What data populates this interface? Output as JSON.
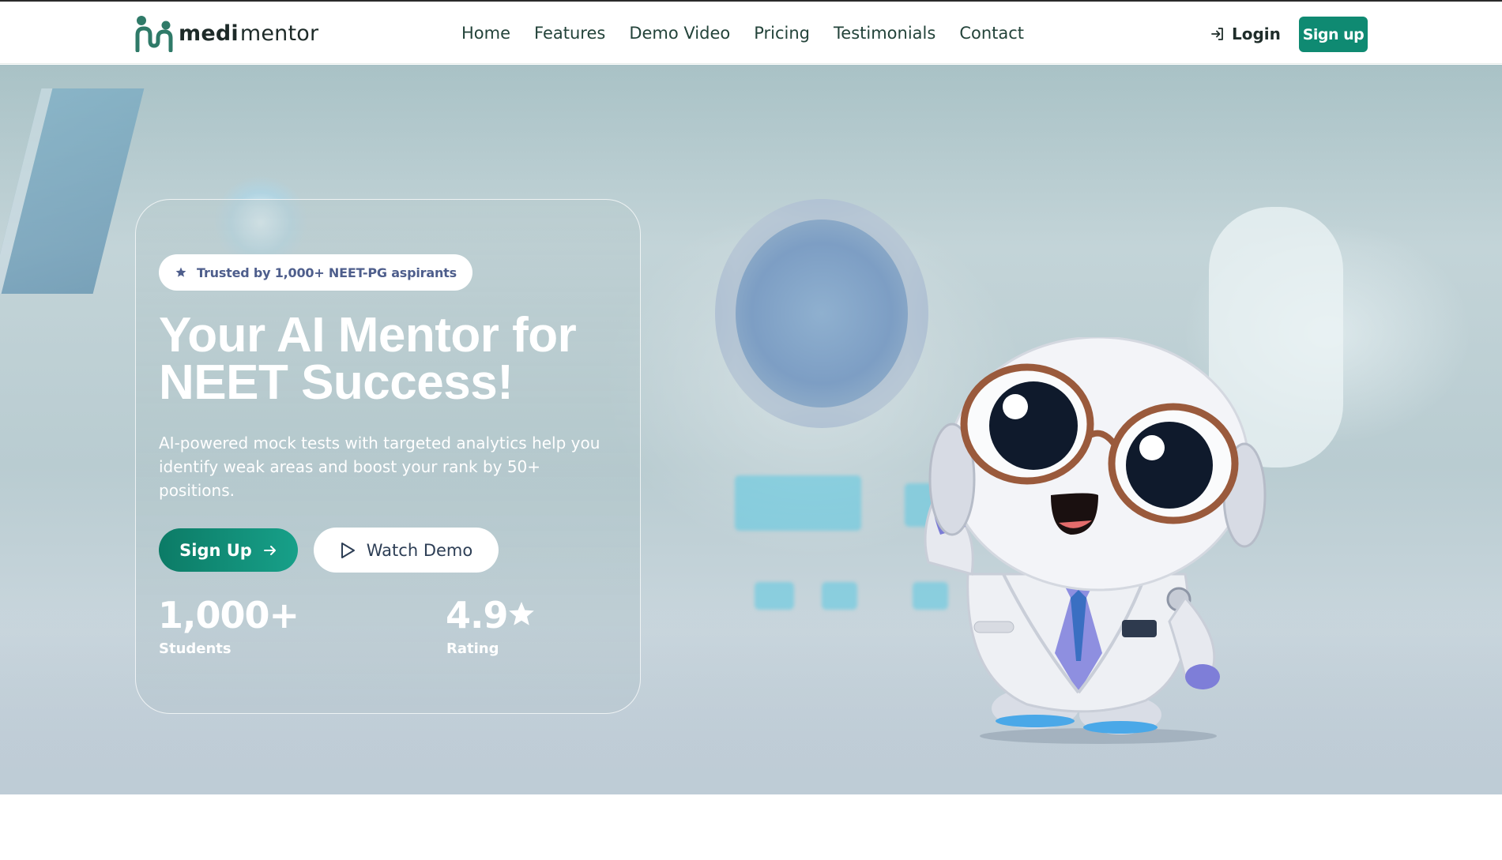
{
  "brand": {
    "name_bold": "medi",
    "name_light": "mentor"
  },
  "nav": {
    "links": [
      "Home",
      "Features",
      "Demo Video",
      "Pricing",
      "Testimonials",
      "Contact"
    ],
    "login": "Login",
    "signup": "Sign up"
  },
  "hero": {
    "badge": "Trusted by 1,000+ NEET-PG aspirants",
    "headline_line1": "Your AI Mentor for",
    "headline_line2": "NEET Success!",
    "subtitle": "AI-powered mock tests with targeted analytics help you identify weak areas and boost your rank by 50+ positions.",
    "cta_primary": "Sign Up",
    "cta_secondary": "Watch Demo",
    "stats": [
      {
        "value": "1,000+",
        "label": "Students"
      },
      {
        "value": "4.9",
        "label": "Rating"
      }
    ]
  },
  "colors": {
    "accent": "#0f8a72",
    "badge_text": "#4e5e8c"
  },
  "icons": {
    "logo": "two-people-logo",
    "login": "login-arrow-icon",
    "badge": "star-icon",
    "cta_primary": "arrow-right-icon",
    "cta_secondary": "play-icon",
    "rating": "star-icon"
  }
}
